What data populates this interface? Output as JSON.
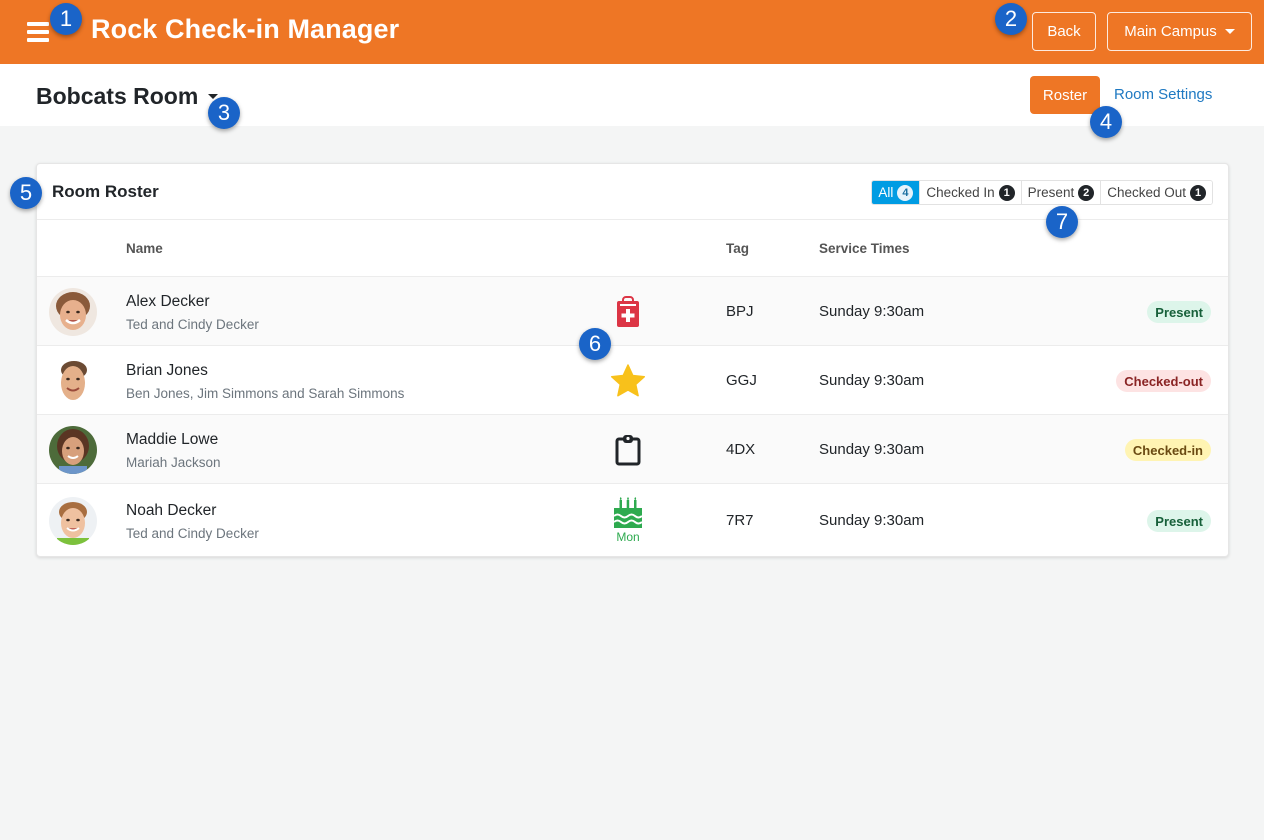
{
  "header": {
    "menu_icon": "hamburger-icon",
    "title": "Rock Check-in Manager",
    "back_label": "Back",
    "campus_label": "Main Campus"
  },
  "subheader": {
    "room_name": "Bobcats Room",
    "roster_label": "Roster",
    "settings_label": "Room Settings"
  },
  "colors": {
    "brand": "#ee7625",
    "filter_active": "#009ce3",
    "link": "#1f79c2",
    "callout": "#1a64c8"
  },
  "roster": {
    "title": "Room Roster",
    "filters": [
      {
        "label": "All",
        "count": "4",
        "active": true
      },
      {
        "label": "Checked In",
        "count": "1",
        "active": false
      },
      {
        "label": "Present",
        "count": "2",
        "active": false
      },
      {
        "label": "Checked Out",
        "count": "1",
        "active": false
      }
    ],
    "columns": {
      "name": "Name",
      "tag": "Tag",
      "service_times": "Service Times"
    },
    "rows": [
      {
        "name": "Alex Decker",
        "parents": "Ted and Cindy Decker",
        "icon": "medical-clipboard-icon",
        "icon_sub": "",
        "tag": "BPJ",
        "service": "Sunday 9:30am",
        "status": "Present",
        "status_type": "present"
      },
      {
        "name": "Brian Jones",
        "parents": "Ben Jones, Jim Simmons and Sarah Simmons",
        "icon": "star-icon",
        "icon_sub": "",
        "tag": "GGJ",
        "service": "Sunday 9:30am",
        "status": "Checked-out",
        "status_type": "out"
      },
      {
        "name": "Maddie Lowe",
        "parents": "Mariah Jackson",
        "icon": "clipboard-icon",
        "icon_sub": "",
        "tag": "4DX",
        "service": "Sunday 9:30am",
        "status": "Checked-in",
        "status_type": "in"
      },
      {
        "name": "Noah Decker",
        "parents": "Ted and Cindy Decker",
        "icon": "birthday-cake-icon",
        "icon_sub": "Mon",
        "tag": "7R7",
        "service": "Sunday 9:30am",
        "status": "Present",
        "status_type": "present"
      }
    ]
  },
  "callouts": [
    "1",
    "2",
    "3",
    "4",
    "5",
    "6",
    "7"
  ]
}
